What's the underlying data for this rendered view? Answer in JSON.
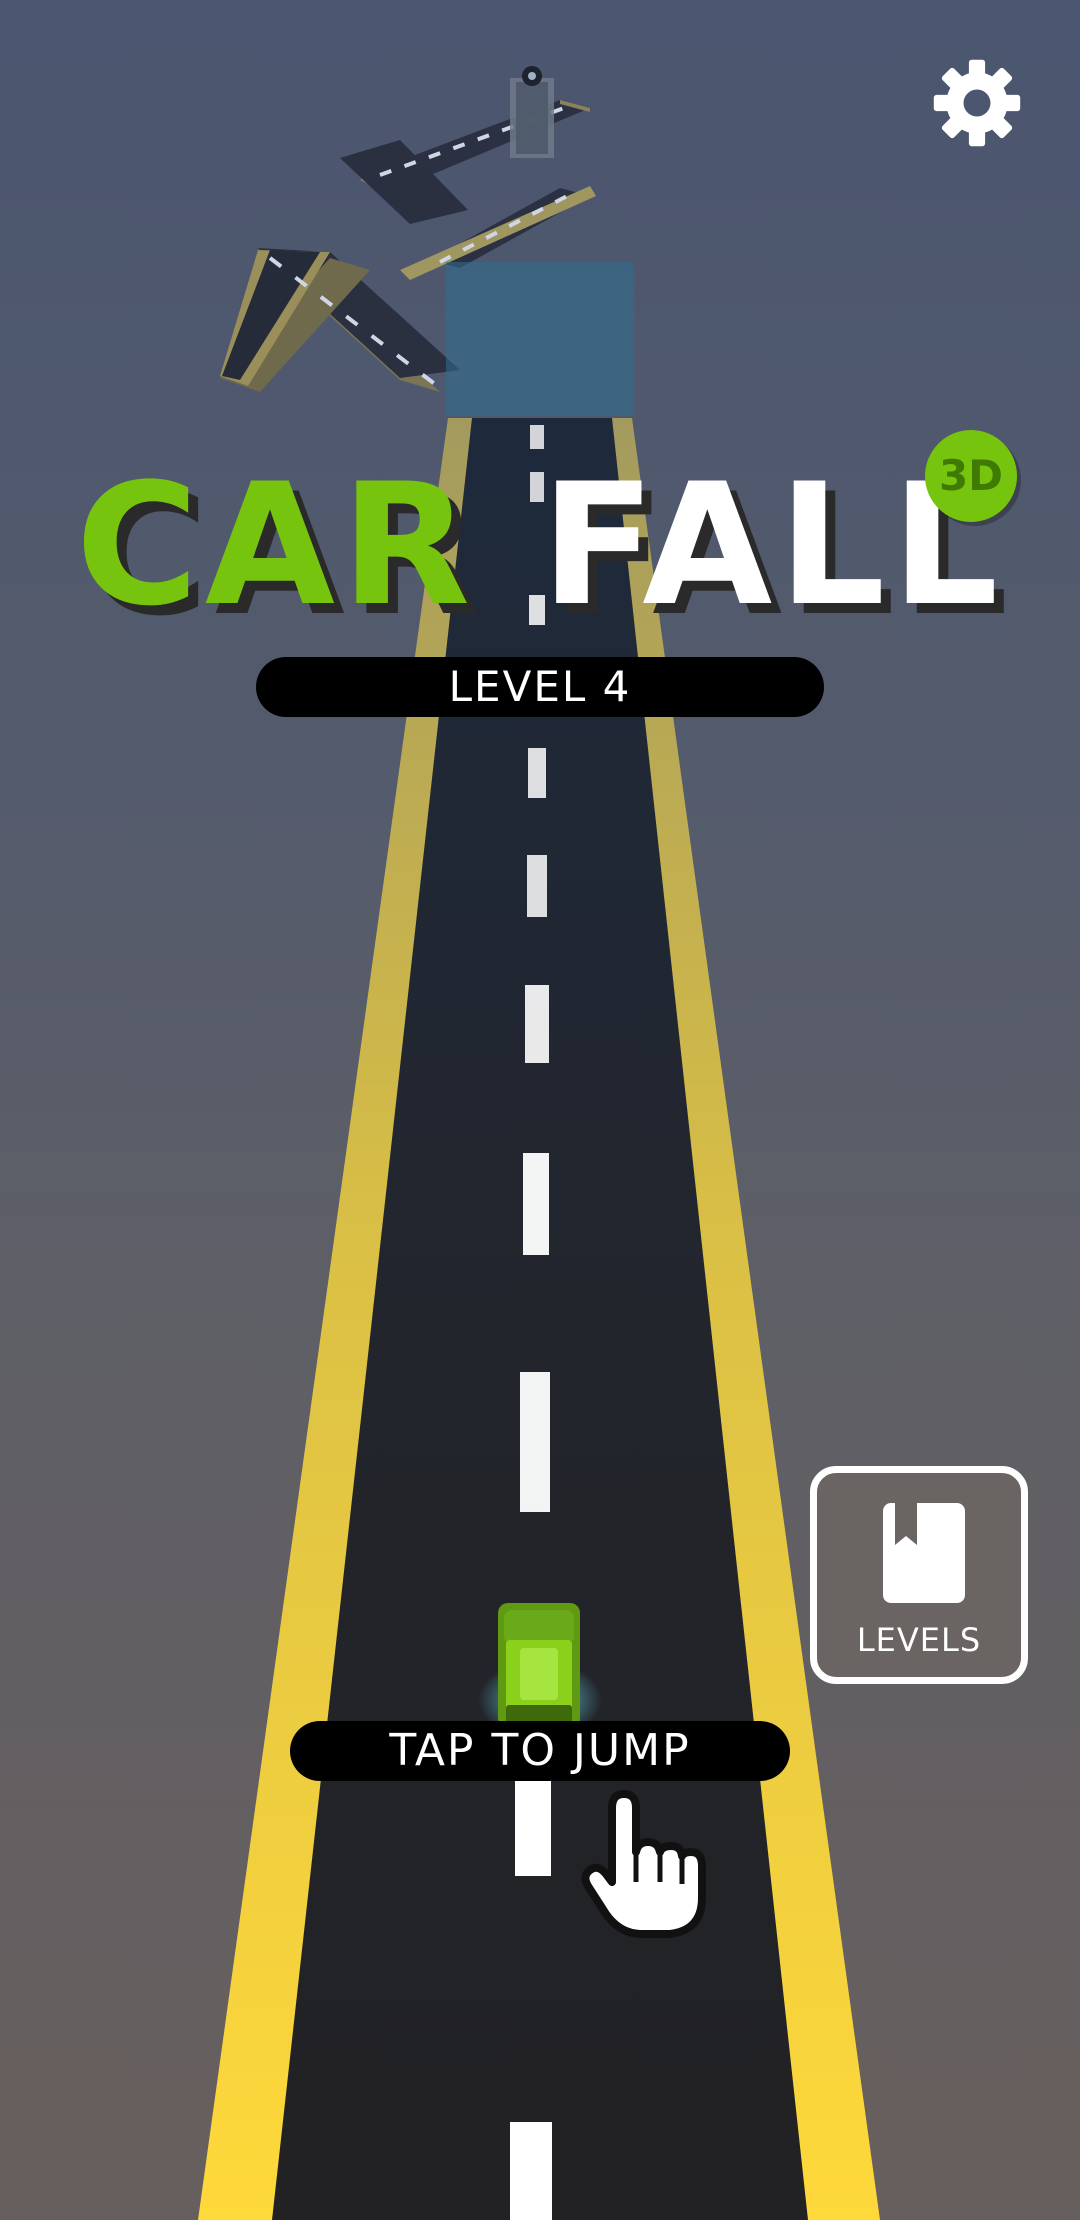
{
  "title": {
    "word1": "CAR",
    "word2": "FALL",
    "badge": "3D"
  },
  "level": {
    "label": "LEVEL 4"
  },
  "hint": {
    "tap_label": "TAP TO JUMP"
  },
  "levels_button": {
    "label": "LEVELS",
    "icon": "book-icon"
  },
  "settings": {
    "icon": "gear-icon"
  },
  "tutorial": {
    "icon": "pointer-hand-icon"
  },
  "colors": {
    "road": "#1f2329",
    "road_edge": "#f2cf3a",
    "lane_marking": "#ffffff",
    "car": "#8bd11c",
    "brand_green": "#76c40d",
    "sky_top": "#4a556f",
    "sky_bottom": "#675f5d"
  }
}
